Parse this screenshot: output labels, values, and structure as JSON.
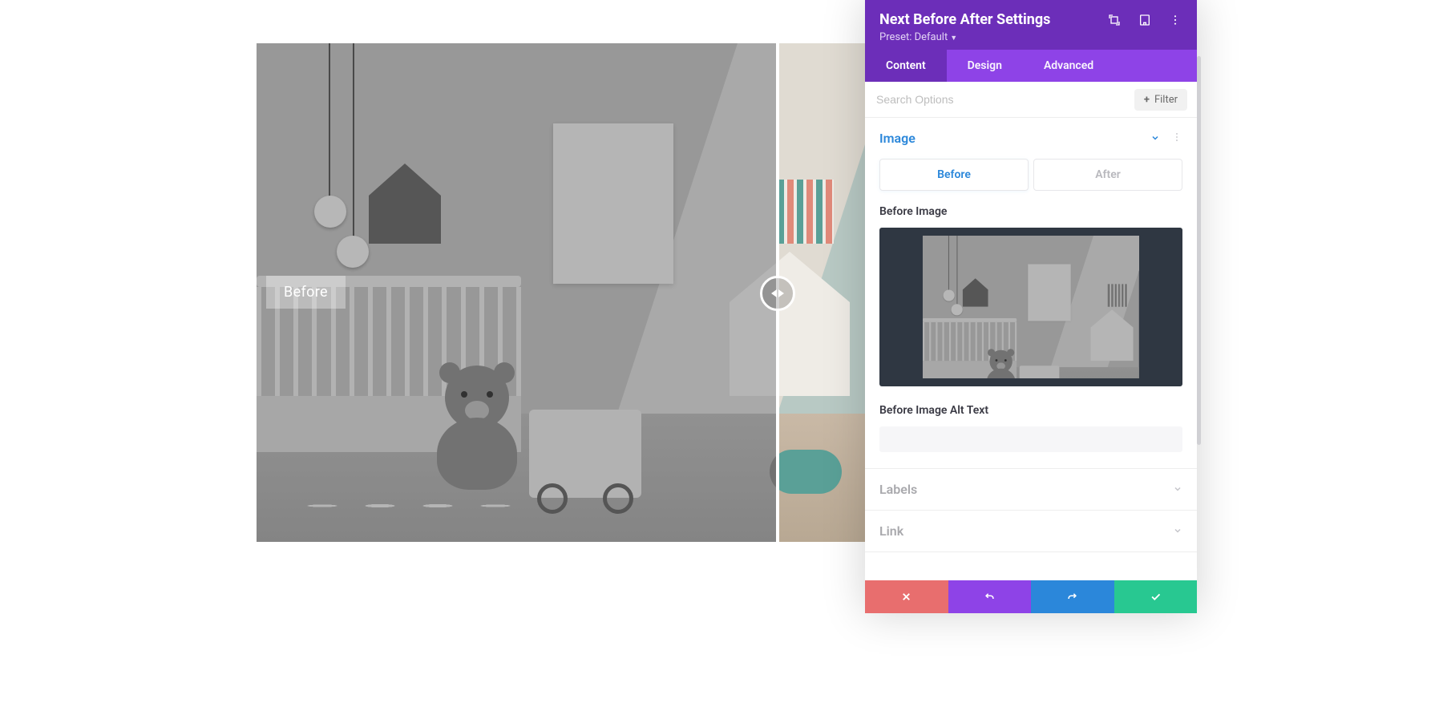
{
  "header": {
    "title": "Next Before After Settings",
    "preset_label": "Preset: Default"
  },
  "tabs": {
    "content": "Content",
    "design": "Design",
    "advanced": "Advanced"
  },
  "search": {
    "placeholder": "Search Options",
    "filter_label": "Filter"
  },
  "sections": {
    "image": {
      "title": "Image",
      "seg_before": "Before",
      "seg_after": "After",
      "before_image_label": "Before Image",
      "before_alt_label": "Before Image Alt Text",
      "before_alt_value": ""
    },
    "labels": {
      "title": "Labels"
    },
    "link": {
      "title": "Link"
    }
  },
  "preview": {
    "before_overlay_label": "Before"
  }
}
